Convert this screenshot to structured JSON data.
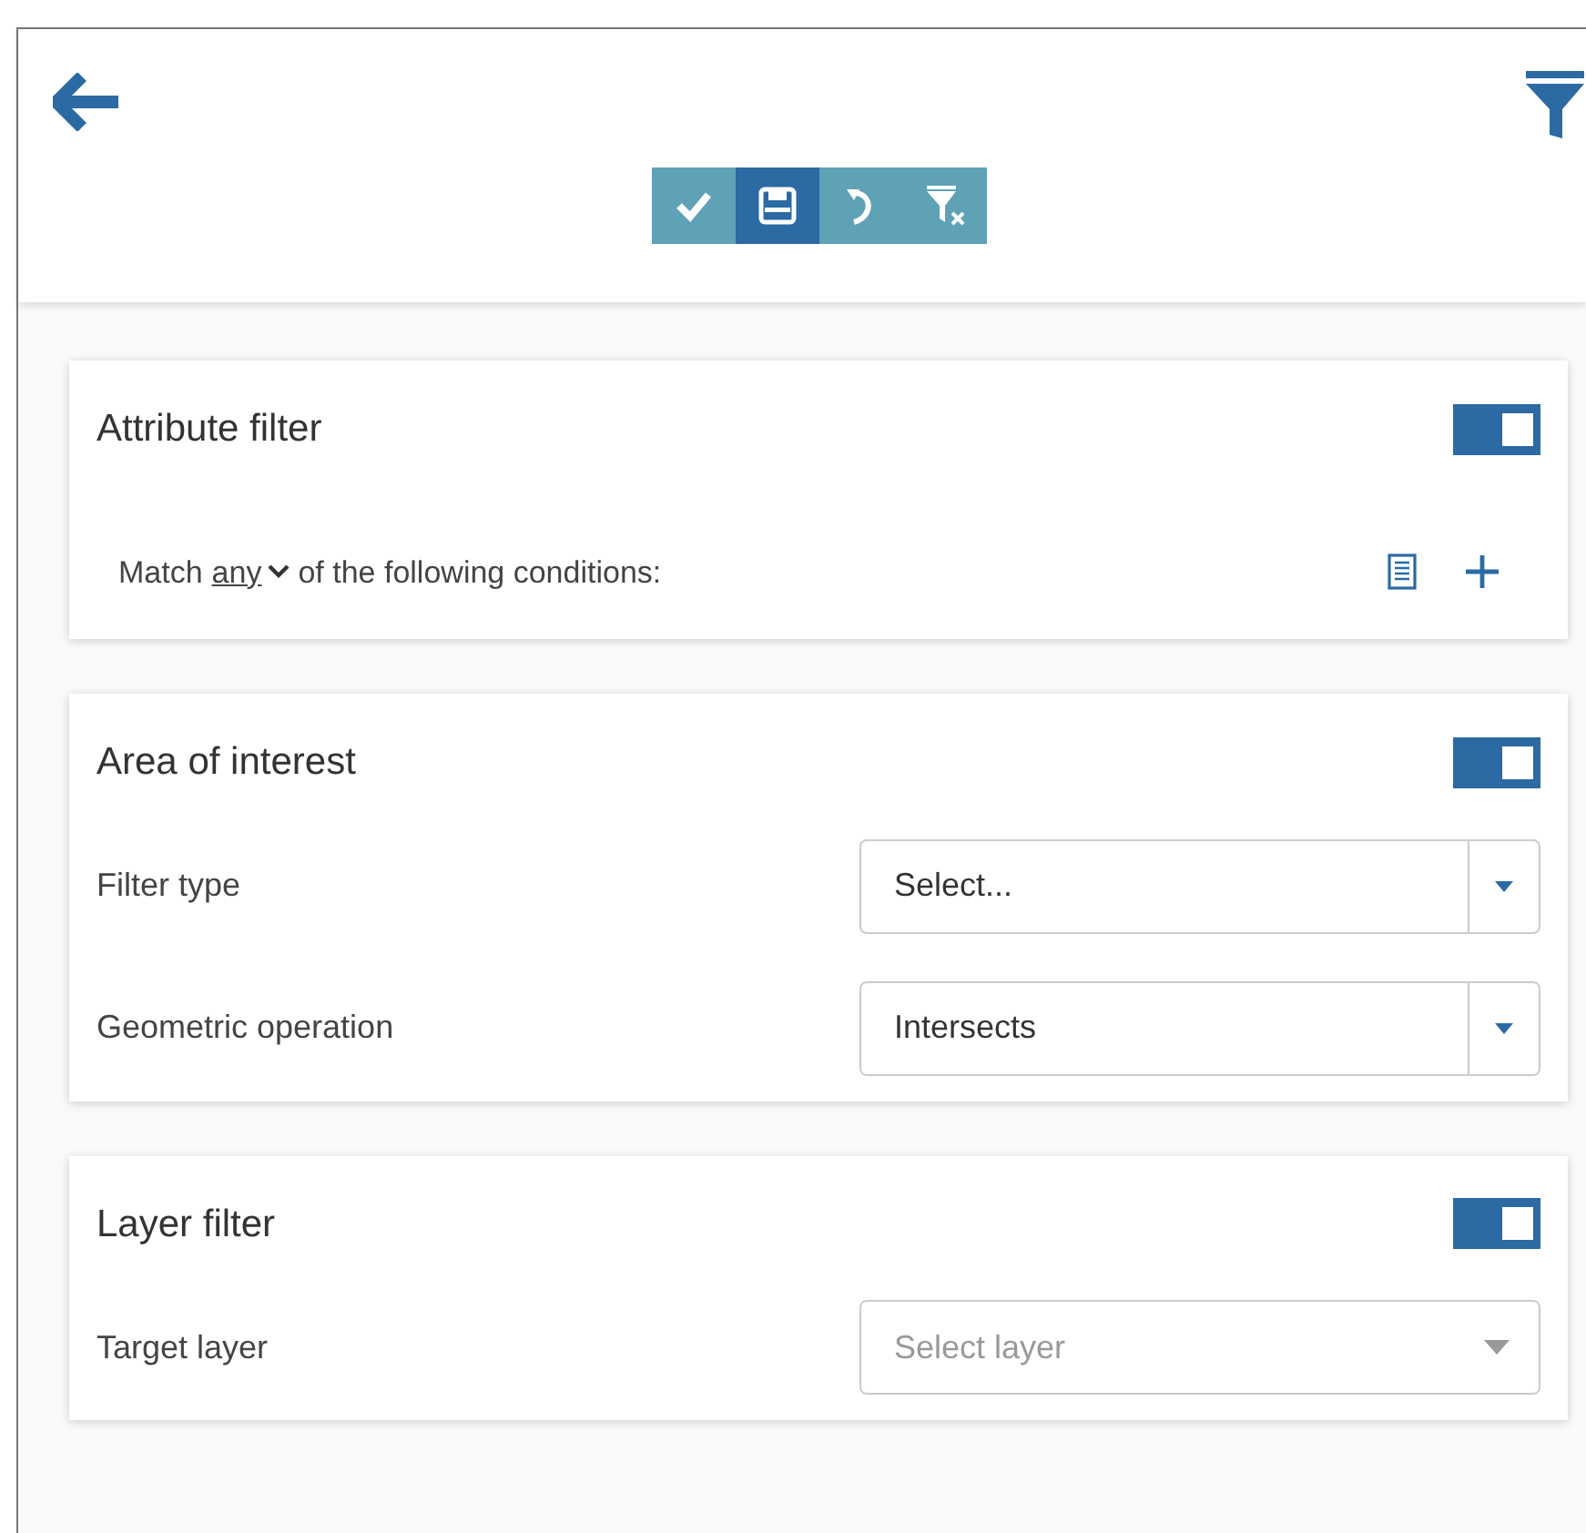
{
  "toolbar": [
    {
      "kind": "check",
      "selected": false
    },
    {
      "kind": "save",
      "selected": true
    },
    {
      "kind": "undo",
      "selected": false
    },
    {
      "kind": "clear-filter",
      "selected": false
    }
  ],
  "sections": [
    {
      "title": "Attribute filter",
      "on": true,
      "match": {
        "prefix": "Match",
        "mode": "any",
        "suffix": "of the following conditions:"
      }
    },
    {
      "title": "Area of interest",
      "on": true,
      "fields": [
        {
          "label": "Filter type",
          "kind": "split",
          "value": "Select..."
        },
        {
          "label": "Geometric operation",
          "kind": "split",
          "value": "Intersects"
        }
      ]
    },
    {
      "title": "Layer filter",
      "on": true,
      "fields": [
        {
          "label": "Target layer",
          "kind": "plain",
          "placeholder": "Select layer"
        }
      ]
    }
  ]
}
